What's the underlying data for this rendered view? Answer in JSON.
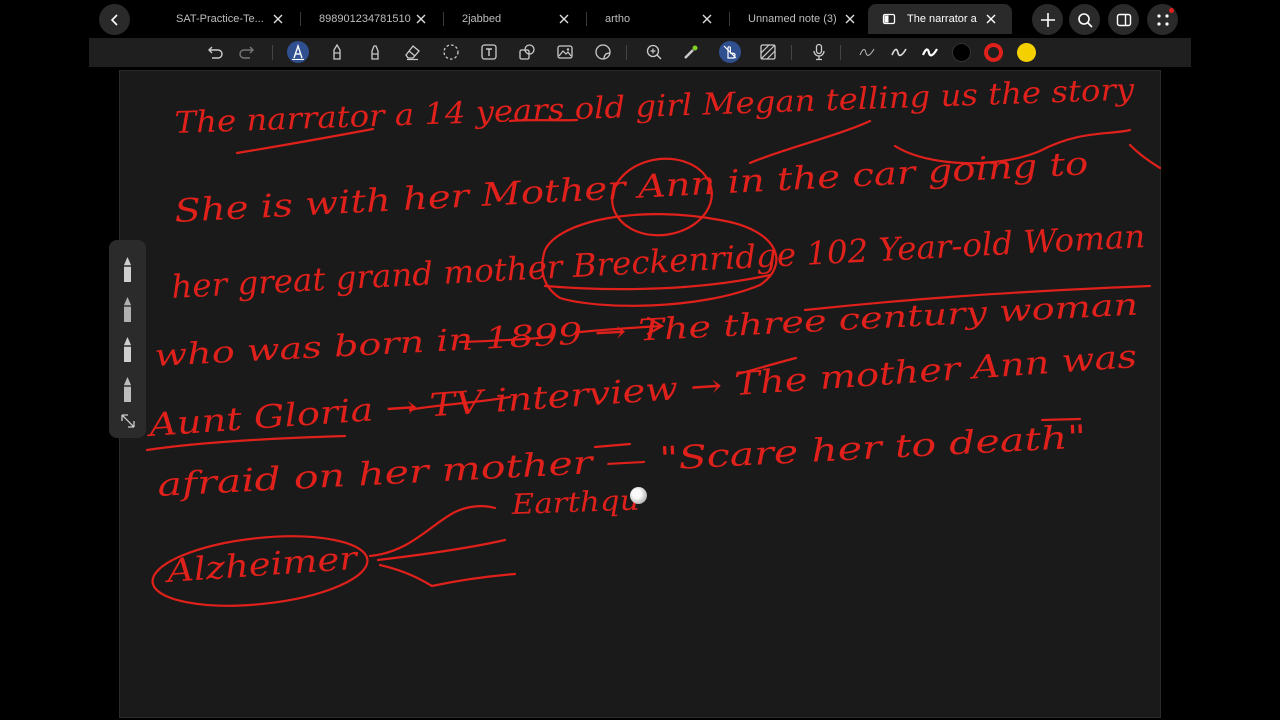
{
  "tabs": [
    {
      "label": "SAT-Practice-Te...",
      "active": false
    },
    {
      "label": "898901234781510",
      "active": false
    },
    {
      "label": "2jabbed",
      "active": false
    },
    {
      "label": "artho",
      "active": false
    },
    {
      "label": "Unnamed note (3)",
      "active": false
    },
    {
      "label": "The narrator a",
      "active": true
    }
  ],
  "colors": {
    "ink": "#e0201a",
    "active_tool": "#2f4f8f",
    "swatch_black": "#000000",
    "swatch_red": "#e0201a",
    "swatch_yellow": "#f5d000"
  },
  "icons": {
    "tabbar": [
      "back-icon",
      "note-icon",
      "plus-icon",
      "search-icon",
      "split-view-icon",
      "apps-grid-icon"
    ],
    "toolbar": [
      "undo-icon",
      "redo-icon",
      "pen-icon",
      "pencil-icon",
      "highlighter-icon",
      "eraser-icon",
      "lasso-icon",
      "text-icon",
      "shapes-icon",
      "image-icon",
      "sticker-icon",
      "zoom-icon",
      "laser-icon",
      "hand-touch-icon",
      "pattern-icon",
      "microphone-icon"
    ],
    "palette": [
      "pen-icon",
      "pen-icon",
      "pen-icon",
      "pen-icon",
      "collapse-icon"
    ]
  },
  "handwriting": [
    "The narrator a 14 years old girl Megan telling us the story",
    "She is with her Mother Ann in the car going to",
    "her great grand mother Breckenridge 102 Year-old Woman",
    "who was born in 1899 → The three century woman",
    "Aunt Gloria → TV interview → The mother Ann was",
    "afraid on her mother — \"Scare her to death\"",
    "Earthqu",
    "Alzheimer"
  ]
}
